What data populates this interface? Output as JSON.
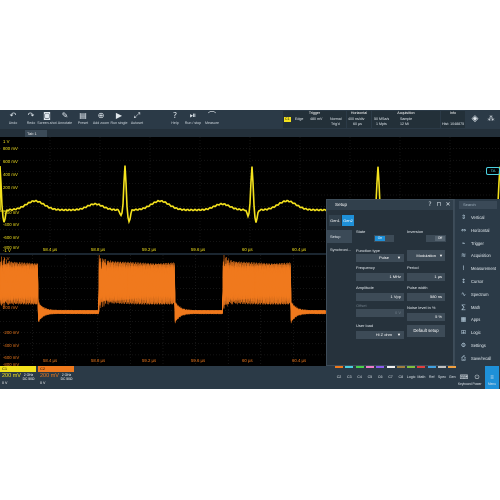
{
  "toolbar": {
    "buttons": [
      {
        "label": "Undo",
        "icon": "undo-icon"
      },
      {
        "label": "Redo",
        "icon": "redo-icon"
      },
      {
        "label": "Screen-shot",
        "icon": "camera-icon"
      },
      {
        "label": "Annotate",
        "icon": "pen-icon"
      },
      {
        "label": "Preset",
        "icon": "preset-icon"
      },
      {
        "label": "Add zoom",
        "icon": "zoom-icon"
      },
      {
        "label": "Run single",
        "icon": "run-single-icon"
      },
      {
        "label": "Autoset",
        "icon": "autoset-icon"
      },
      {
        "label": "Help",
        "icon": "help-icon"
      },
      {
        "label": "Run / stop",
        "icon": "run-stop-icon"
      },
      {
        "label": "Measure",
        "icon": "measure-icon"
      }
    ],
    "trigger": {
      "title": "Trigger",
      "source": "C1",
      "type": "Edge",
      "level": "480 mV",
      "mode": "Normal",
      "slope": "Trig'd"
    },
    "horizontal": {
      "title": "Horizontal",
      "scale": "400 ns/div",
      "position": "60 µs"
    },
    "acquisition": {
      "title": "Acquisition",
      "rate": "50 MSa/s",
      "mode": "Sample",
      "record": "1 Mpts",
      "points": "12 Mi"
    },
    "info": {
      "title": "Info",
      "count": "Hist: 1048875"
    }
  },
  "tab": {
    "label": "Tab 1"
  },
  "diagram1": {
    "y_labels": [
      "1 V",
      "800 mV",
      "600 mV",
      "400 mV",
      "200 mV",
      "-200 mV",
      "-400 mV",
      "-600 mV",
      "-800 mV",
      "-1 V"
    ],
    "x_labels": [
      "58.4 µs",
      "58.8 µs",
      "59.2 µs",
      "59.6 µs",
      "60 µs",
      "60.4 µs",
      "60.8 µs"
    ],
    "marker": "TA"
  },
  "diagram2": {
    "y_labels": [
      "1 V",
      "800 mV",
      "600 mV",
      "400 mV",
      "200 mV",
      "-200 mV",
      "-400 mV",
      "-600 mV",
      "-800 mV"
    ],
    "x_labels": [
      "58.4 µs",
      "58.8 µs",
      "59.2 µs",
      "59.6 µs",
      "60 µs",
      "60.4 µs",
      "60.8 µs"
    ]
  },
  "channels": [
    {
      "name": "C1",
      "scale": "200 mV",
      "coupling": "2 GHz DC 50Ω",
      "offset": "0 V",
      "color": "#f4e21d"
    },
    {
      "name": "C2",
      "scale": "200 mV",
      "coupling": "2 GHz DC 50Ω",
      "offset": "0 V",
      "color": "#f07a1d"
    }
  ],
  "bottom_buttons": [
    {
      "label": "C2",
      "color": "#f07a1d"
    },
    {
      "label": "C3",
      "color": "#4bd0e0"
    },
    {
      "label": "C4",
      "color": "#4ad04a"
    },
    {
      "label": "C5",
      "color": "#f07ac8"
    },
    {
      "label": "C6",
      "color": "#8a5cf0"
    },
    {
      "label": "C7",
      "color": "#f0f0f0"
    },
    {
      "label": "C8",
      "color": "#a08040"
    },
    {
      "label": "Logic",
      "color": "#80c040"
    },
    {
      "label": "Math",
      "color": "#e04040"
    },
    {
      "label": "Ref",
      "color": "#40a0e0"
    },
    {
      "label": "Spec",
      "color": "#c0c0c0"
    },
    {
      "label": "Gen",
      "color": "#f0a040"
    }
  ],
  "dialog": {
    "title": "Setup",
    "tabs": [
      "Gen1",
      "Gen2"
    ],
    "side_items": [
      "Setup",
      "Synchroni..."
    ],
    "state_label": "State",
    "state_value": "On",
    "inversion_label": "Inversion",
    "inversion_value": "Off",
    "function_type_label": "Function type",
    "function_type_value": "Pulse",
    "modulation_label": "Modulation",
    "frequency_label": "Frequency",
    "frequency_value": "1  MHz",
    "period_label": "Period",
    "period_value": "1  µs",
    "amplitude_label": "Amplitude",
    "amplitude_value": "1  Vpp",
    "pulse_width_label": "Pulse width",
    "pulse_width_value": "580  ns",
    "offset_label": "Offset",
    "offset_value": "0  V",
    "noise_label": "Noise level in %",
    "noise_value": "5  %",
    "user_load_label": "User load",
    "user_load_value": "Hi Z ohm",
    "default_setup": "Default setup"
  },
  "side_menu": {
    "search": "Search",
    "items": [
      {
        "label": "Vertical",
        "icon": "vertical-icon"
      },
      {
        "label": "Horizontal",
        "icon": "horizontal-icon"
      },
      {
        "label": "Trigger",
        "icon": "trigger-icon"
      },
      {
        "label": "Acquisition",
        "icon": "acquisition-icon"
      },
      {
        "label": "Measurement",
        "icon": "measurement-icon"
      },
      {
        "label": "Cursor",
        "icon": "cursor-icon"
      },
      {
        "label": "Spectrum",
        "icon": "spectrum-icon"
      },
      {
        "label": "Math",
        "icon": "math-icon"
      },
      {
        "label": "Apps",
        "icon": "apps-icon"
      },
      {
        "label": "Logic",
        "icon": "logic-icon"
      },
      {
        "label": "Settings",
        "icon": "settings-icon"
      },
      {
        "label": "Save/recall",
        "icon": "save-icon"
      }
    ]
  },
  "bottom_right": {
    "keyboard": "Keyboard",
    "power": "Power",
    "menu": "Menu"
  }
}
